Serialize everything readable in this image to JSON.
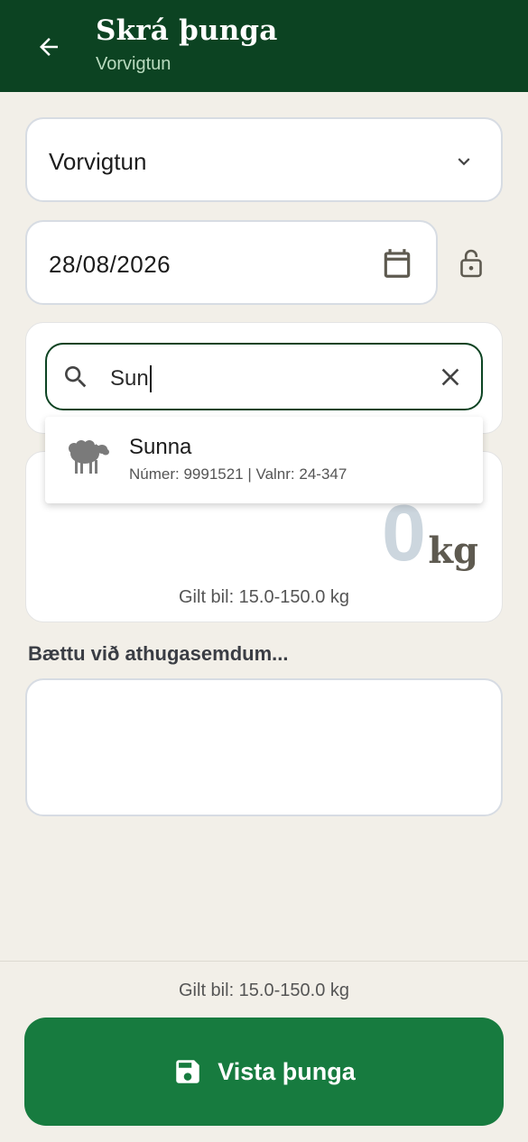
{
  "header": {
    "title": "Skrá þunga",
    "subtitle": "Vorvigtun"
  },
  "form": {
    "weighing_type": "Vorvigtun",
    "date": "28/08/2026",
    "search": {
      "value": "Sun"
    },
    "weight": {
      "value": "0",
      "unit": "kg",
      "range_text": "Gilt bil: 15.0-150.0 kg"
    },
    "notes_label": "Bættu við athugasemdum..."
  },
  "suggestion": {
    "name": "Sunna",
    "meta": "Númer: 9991521 | Valnr: 24-347"
  },
  "footer": {
    "range_text": "Gilt bil: 15.0-150.0 kg",
    "save_label": "Vista þunga"
  },
  "colors": {
    "header_bg": "#0c4322",
    "accent": "#177b3f",
    "background": "#f2efe8"
  }
}
